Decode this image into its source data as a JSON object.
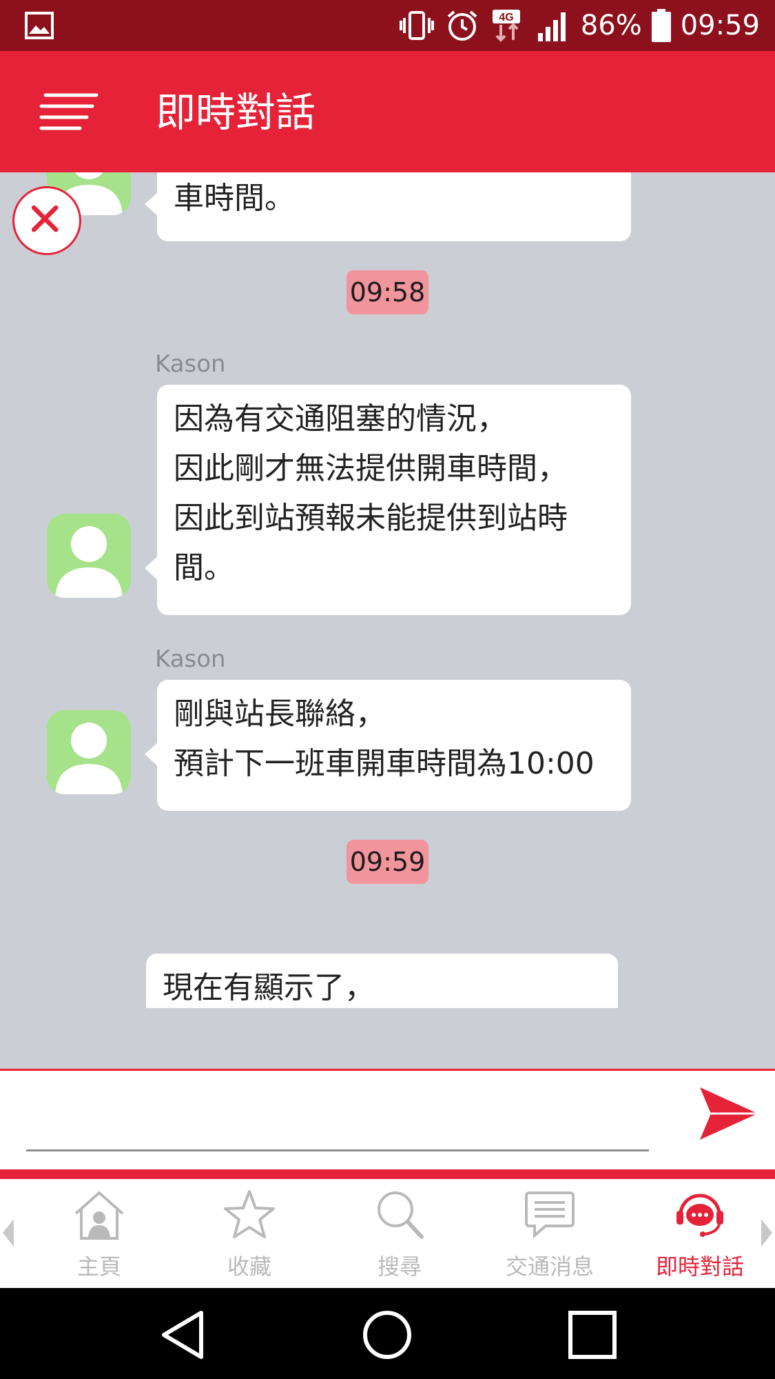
{
  "status_bar": {
    "battery_percent": "86%",
    "time": "09:59",
    "network_type": "4G",
    "icons": [
      "gallery-icon",
      "vibrate-icon",
      "alarm-icon",
      "data-arrows-icon",
      "signal-icon",
      "battery-icon"
    ]
  },
  "app_bar": {
    "title": "即時對話",
    "menu_icon": "menu-icon"
  },
  "chat": {
    "messages": [
      {
        "sender": "",
        "text": "車時間。"
      },
      {
        "time": "09:58"
      },
      {
        "sender": "Kason",
        "text": "因為有交通阻塞的情況，\n因此剛才無法提供開車時間，\n因此到站預報未能提供到站時\n間。"
      },
      {
        "sender": "Kason",
        "text": "剛與站長聯絡，\n預計下一班車開車時間為10:00"
      },
      {
        "time": "09:59"
      },
      {
        "sender": "",
        "text": "現在有顯示了，"
      }
    ]
  },
  "input": {
    "value": "",
    "placeholder": ""
  },
  "bottom_nav": {
    "items": [
      {
        "label": "主頁",
        "icon": "home-icon"
      },
      {
        "label": "收藏",
        "icon": "star-icon"
      },
      {
        "label": "搜尋",
        "icon": "search-icon"
      },
      {
        "label": "交通消息",
        "icon": "message-icon"
      },
      {
        "label": "即時對話",
        "icon": "chat-headset-icon",
        "active": true
      }
    ]
  },
  "colors": {
    "accent": "#e52237",
    "status_bar": "#8c111d",
    "chat_background": "#cbcfd5",
    "time_chip": "#f2949c",
    "avatar": "#a5e28a"
  }
}
